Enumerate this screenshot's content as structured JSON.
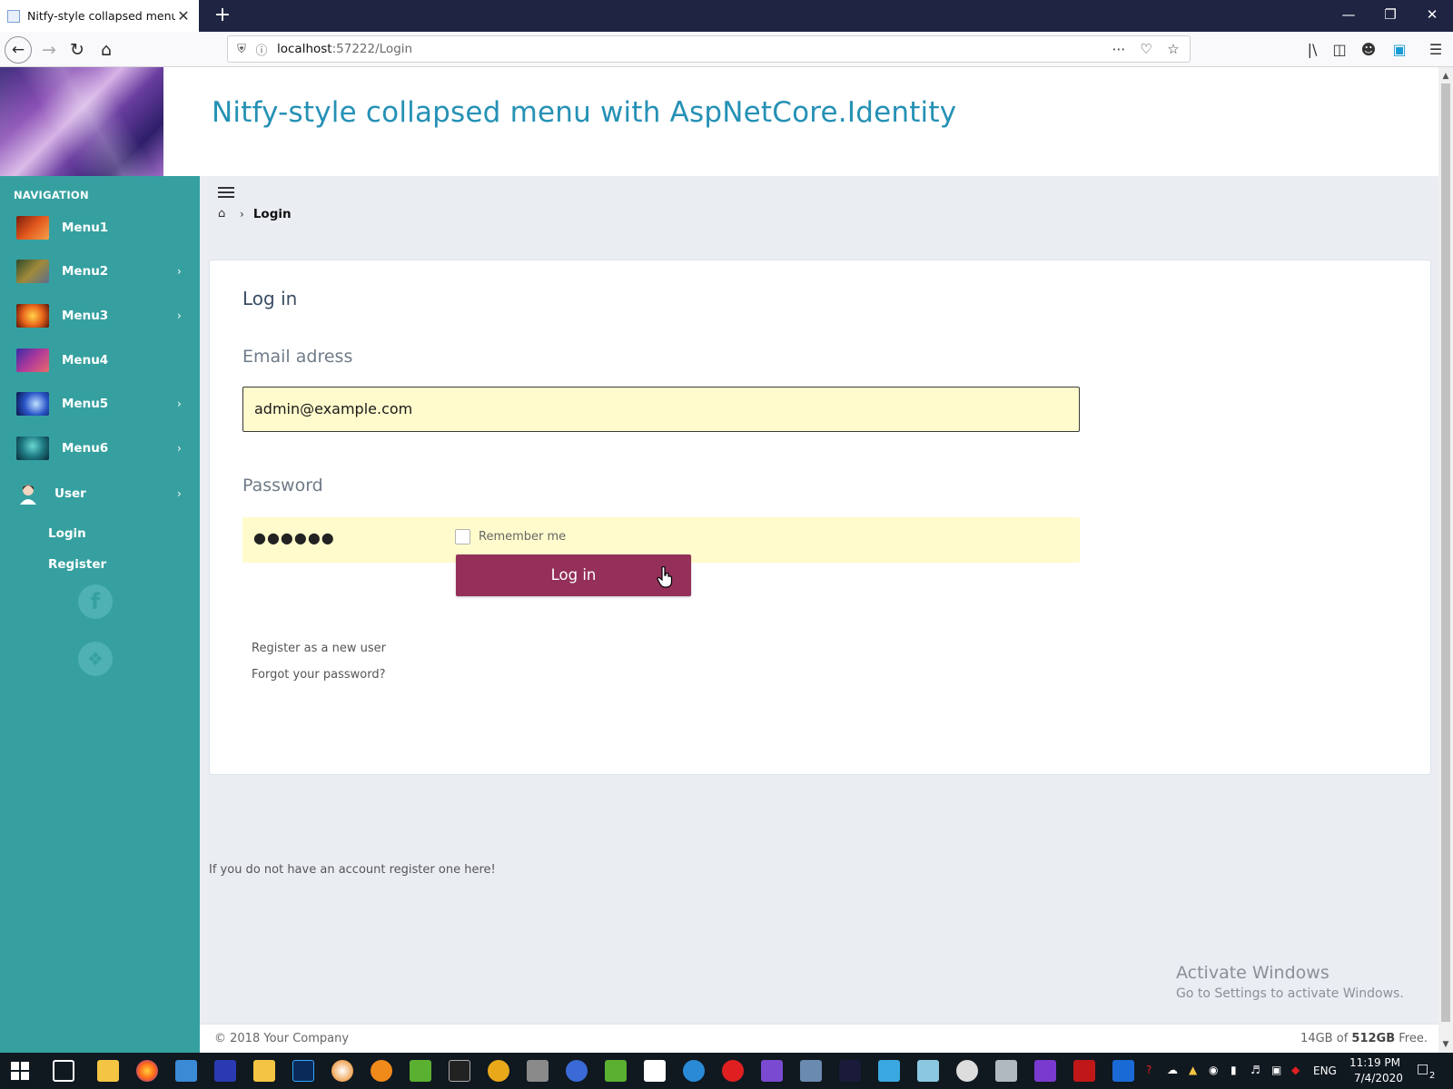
{
  "browser": {
    "tab_title": "Nitfy-style collapsed menu",
    "tab_close": "✕",
    "new_tab": "+",
    "url_host": "localhost",
    "url_path": ":57222/Login",
    "window_minimize": "—",
    "window_restore": "❐",
    "window_close": "✕"
  },
  "header": {
    "title": "Nitfy-style collapsed menu with AspNetCore.Identity"
  },
  "sidebar": {
    "heading": "NAVIGATION",
    "items": [
      {
        "label": "Menu1",
        "has_children": false,
        "thumb_color": "#c9491a"
      },
      {
        "label": "Menu2",
        "has_children": true,
        "thumb_color": "#6b7a3a"
      },
      {
        "label": "Menu3",
        "has_children": true,
        "thumb_color": "#e8651b"
      },
      {
        "label": "Menu4",
        "has_children": false,
        "thumb_color": "#6a3aa8"
      },
      {
        "label": "Menu5",
        "has_children": true,
        "thumb_color": "#2a55c8"
      },
      {
        "label": "Menu6",
        "has_children": true,
        "thumb_color": "#1e7a82"
      }
    ],
    "user": {
      "label": "User",
      "expanded": true
    },
    "sub_items": [
      {
        "label": "Login"
      },
      {
        "label": "Register"
      }
    ],
    "social": {
      "facebook": "f",
      "twitter": "t"
    }
  },
  "breadcrumb": {
    "current": "Login"
  },
  "login": {
    "title": "Log in",
    "email_label": "Email adress",
    "email_value": "admin@example.com",
    "password_label": "Password",
    "password_mask": "●●●●●●",
    "remember_label": "Remember me",
    "remember_checked": false,
    "submit_label": "Log in",
    "register_link": "Register as a new user",
    "forgot_link": "Forgot your password?"
  },
  "footnote": "If you do not have an account register one here!",
  "watermark": {
    "title": "Activate Windows",
    "subtitle": "Go to Settings to activate Windows."
  },
  "footer": {
    "copyright": "© 2018 Your Company",
    "storage_free": "14GB",
    "storage_of": "of",
    "storage_total": "512GB",
    "storage_suffix": "Free."
  },
  "taskbar": {
    "language": "ENG",
    "time": "11:19 PM",
    "date": "7/4/2020",
    "notifications": "2"
  },
  "colors": {
    "sidebar": "#36a0a0",
    "accent_title": "#2591b5",
    "button": "#94305a",
    "input_fill": "#fffbcc"
  }
}
